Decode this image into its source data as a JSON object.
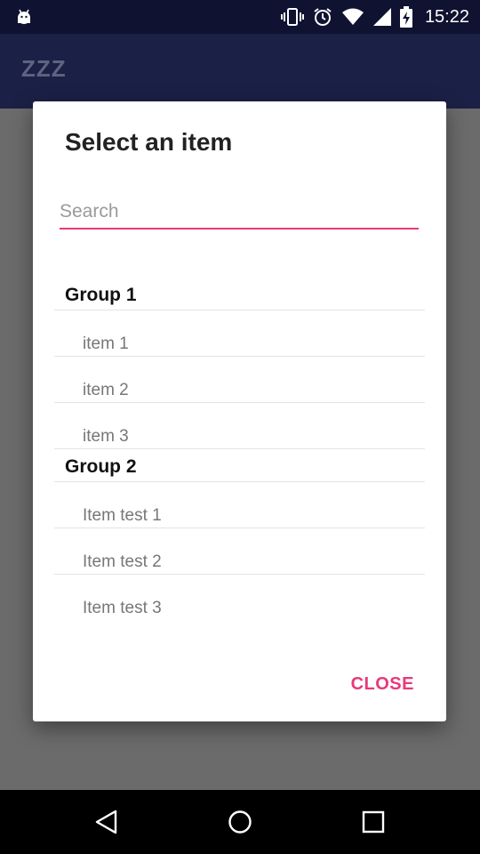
{
  "status_bar": {
    "time": "15:22",
    "icons": [
      "android-icon",
      "vibrate-icon",
      "alarm-icon",
      "wifi-icon",
      "signal-icon",
      "battery-charging-icon"
    ]
  },
  "app_bar": {
    "title": "ZZZ"
  },
  "dialog": {
    "title": "Select an item",
    "search": {
      "placeholder": "Search",
      "value": ""
    },
    "groups": [
      {
        "label": "Group 1",
        "items": [
          "item 1",
          "item 2",
          "item 3"
        ]
      },
      {
        "label": "Group 2",
        "items": [
          "Item test 1",
          "Item test 2",
          "Item test 3"
        ]
      }
    ],
    "close_label": "CLOSE"
  },
  "nav_bar": {
    "buttons": [
      "back-icon",
      "home-icon",
      "recents-icon"
    ]
  },
  "colors": {
    "accent": "#e8397a",
    "app_bar": "#1b2046",
    "status_bar": "#0f1230",
    "scrim": "#6b6b6b"
  }
}
